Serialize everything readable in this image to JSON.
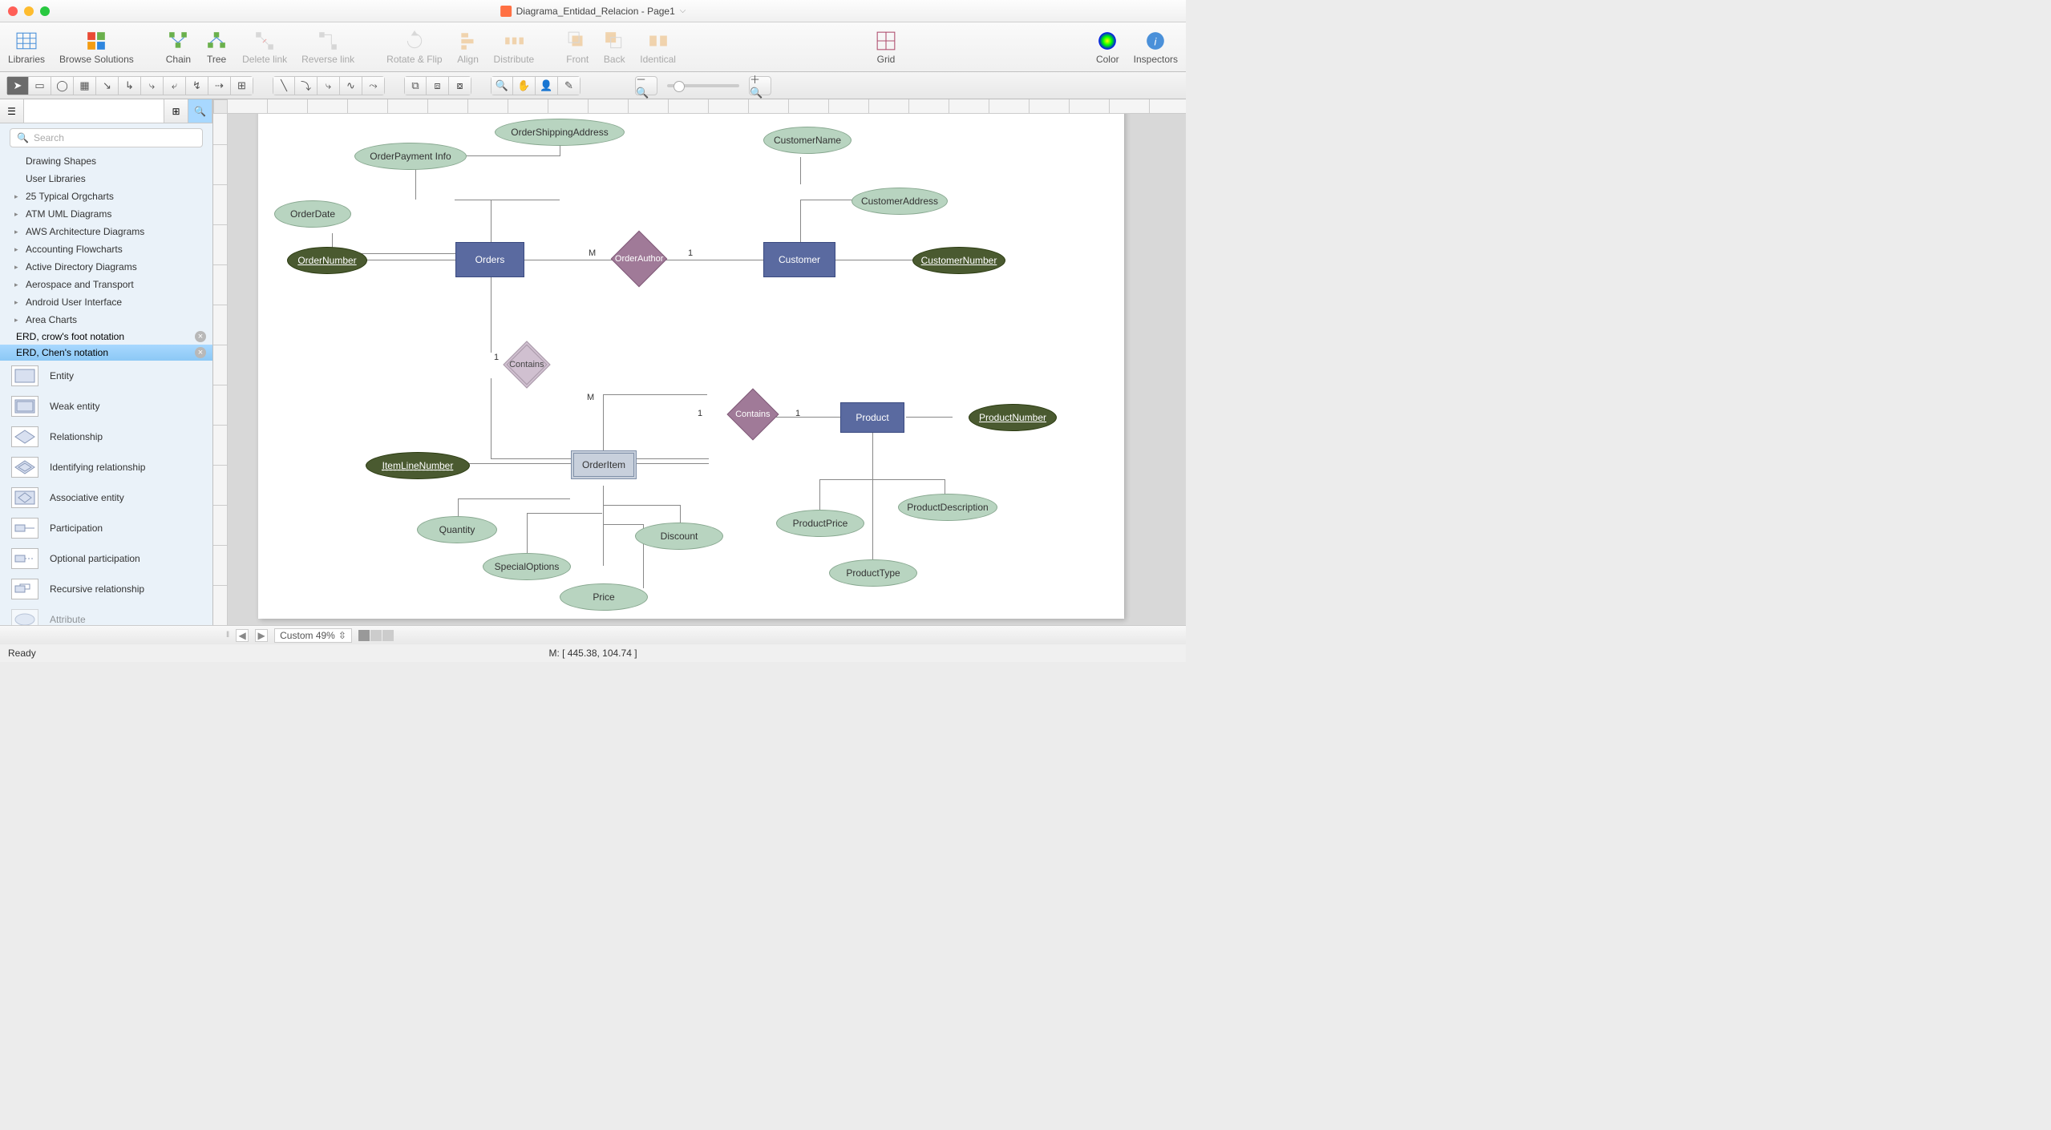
{
  "title": "Diagrama_Entidad_Relacion - Page1",
  "toolbar": {
    "libraries": "Libraries",
    "browse": "Browse Solutions",
    "chain": "Chain",
    "tree": "Tree",
    "delete_link": "Delete link",
    "reverse_link": "Reverse link",
    "rotate": "Rotate & Flip",
    "align": "Align",
    "distribute": "Distribute",
    "front": "Front",
    "back": "Back",
    "identical": "Identical",
    "grid": "Grid",
    "color": "Color",
    "inspectors": "Inspectors"
  },
  "search_placeholder": "Search",
  "libraries_list": [
    {
      "label": "Drawing Shapes",
      "exp": false
    },
    {
      "label": "User Libraries",
      "exp": false
    },
    {
      "label": "25 Typical Orgcharts",
      "exp": true
    },
    {
      "label": "ATM UML Diagrams",
      "exp": true
    },
    {
      "label": "AWS Architecture Diagrams",
      "exp": true
    },
    {
      "label": "Accounting Flowcharts",
      "exp": true
    },
    {
      "label": "Active Directory Diagrams",
      "exp": true
    },
    {
      "label": "Aerospace and Transport",
      "exp": true
    },
    {
      "label": "Android User Interface",
      "exp": true
    },
    {
      "label": "Area Charts",
      "exp": true
    }
  ],
  "stencil_tabs": [
    {
      "label": "ERD, crow's foot notation",
      "selected": false
    },
    {
      "label": "ERD, Chen's notation",
      "selected": true
    }
  ],
  "stencils": [
    "Entity",
    "Weak entity",
    "Relationship",
    "Identifying relationship",
    "Associative entity",
    "Participation",
    "Optional participation",
    "Recursive relationship",
    "Attribute"
  ],
  "pagebar": {
    "zoom": "Custom 49%"
  },
  "status": {
    "ready": "Ready",
    "coords": "M: [ 445.38, 104.74 ]"
  },
  "diagram": {
    "entities": {
      "orders": "Orders",
      "customer": "Customer",
      "product": "Product",
      "orderitem": "OrderItem"
    },
    "relationships": {
      "orderauthor": "OrderAuthor",
      "contains1": "Contains",
      "contains2": "Contains"
    },
    "attributes": {
      "orderdate": "OrderDate",
      "orderpaymentinfo": "OrderPayment Info",
      "ordershipping": "OrderShippingAddress",
      "ordernumber": "OrderNumber",
      "customername": "CustomerName",
      "customeraddress": "CustomerAddress",
      "customernumber": "CustomerNumber",
      "itemlinenumber": "ItemLineNumber",
      "quantity": "Quantity",
      "specialoptions": "SpecialOptions",
      "price": "Price",
      "discount": "Discount",
      "productnumber": "ProductNumber",
      "productprice": "ProductPrice",
      "productdescription": "ProductDescription",
      "producttype": "ProductType"
    },
    "cardinalities": {
      "M": "M",
      "one": "1"
    }
  }
}
